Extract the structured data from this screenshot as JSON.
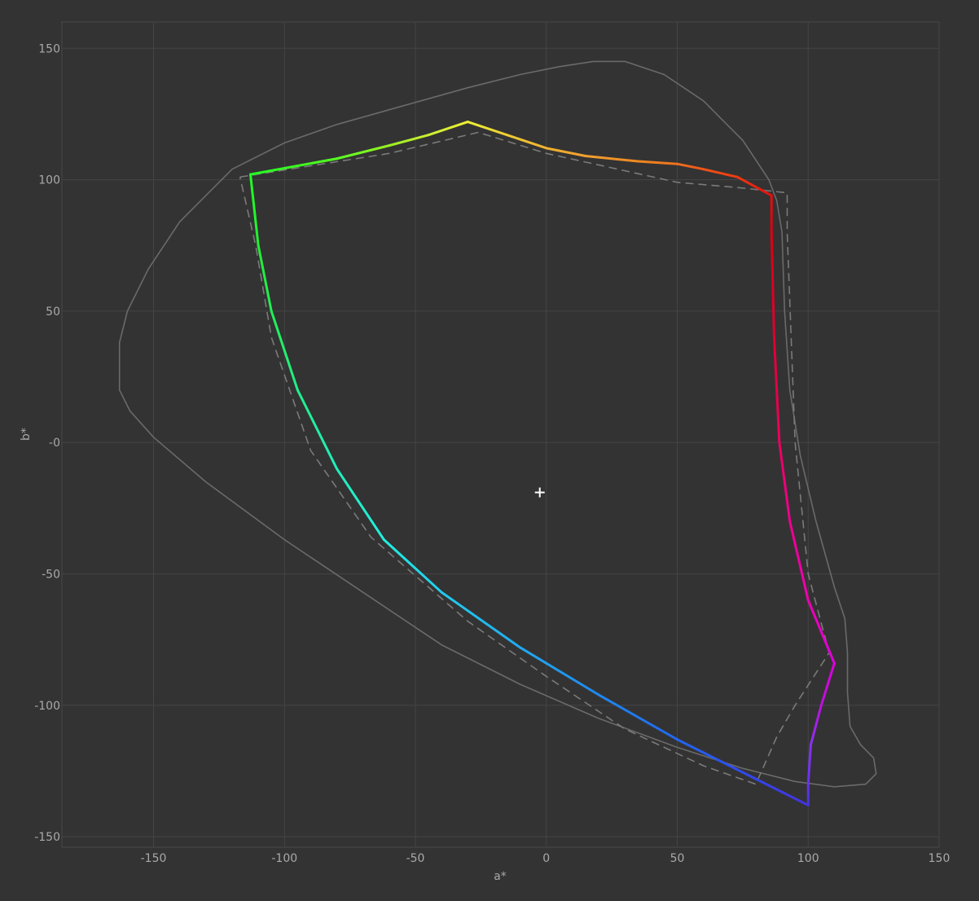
{
  "chart_data": {
    "type": "line",
    "xlabel": "a*",
    "ylabel": "b*",
    "xlim": [
      -185,
      150
    ],
    "ylim": [
      -154,
      160
    ],
    "grid": true,
    "x_ticks": [
      {
        "value": -150,
        "label": "-150"
      },
      {
        "value": -100,
        "label": "-100"
      },
      {
        "value": -50,
        "label": "-50"
      },
      {
        "value": 0,
        "label": "0"
      },
      {
        "value": 50,
        "label": "50"
      },
      {
        "value": 100,
        "label": "100"
      },
      {
        "value": 150,
        "label": "150"
      }
    ],
    "y_ticks": [
      {
        "value": 150,
        "label": "150"
      },
      {
        "value": 100,
        "label": "100"
      },
      {
        "value": 50,
        "label": "50"
      },
      {
        "value": 0,
        "label": "-0"
      },
      {
        "value": -50,
        "label": "-50"
      },
      {
        "value": -100,
        "label": "-100"
      },
      {
        "value": -150,
        "label": "-150"
      }
    ],
    "white_point": {
      "x": -2.5,
      "y": -19
    },
    "series": [
      {
        "style": "solid-gray",
        "color": "#6a6a6a",
        "closed": true,
        "points": [
          [
            18,
            145
          ],
          [
            5,
            143
          ],
          [
            -10,
            140
          ],
          [
            -30,
            135
          ],
          [
            -55,
            128
          ],
          [
            -80,
            121
          ],
          [
            -100,
            114
          ],
          [
            -120,
            104
          ],
          [
            -140,
            84
          ],
          [
            -152,
            66
          ],
          [
            -160,
            50
          ],
          [
            -163,
            38
          ],
          [
            -163,
            20
          ],
          [
            -159,
            12
          ],
          [
            -150,
            2
          ],
          [
            -130,
            -15
          ],
          [
            -100,
            -37
          ],
          [
            -70,
            -57
          ],
          [
            -40,
            -77
          ],
          [
            -10,
            -92
          ],
          [
            20,
            -105
          ],
          [
            50,
            -116
          ],
          [
            75,
            -124
          ],
          [
            95,
            -129
          ],
          [
            110,
            -131
          ],
          [
            122,
            -130
          ],
          [
            126,
            -126
          ],
          [
            125,
            -120
          ],
          [
            120,
            -115
          ],
          [
            116,
            -108
          ],
          [
            115,
            -95
          ],
          [
            115,
            -80
          ],
          [
            114,
            -67
          ],
          [
            110,
            -55
          ],
          [
            103,
            -30
          ],
          [
            97,
            -5
          ],
          [
            93,
            20
          ],
          [
            91,
            50
          ],
          [
            90,
            80
          ],
          [
            88,
            92
          ],
          [
            85,
            100
          ],
          [
            75,
            115
          ],
          [
            60,
            130
          ],
          [
            45,
            140
          ],
          [
            30,
            145
          ]
        ]
      },
      {
        "style": "dashed-gray",
        "color": "#7a7a7a",
        "closed": false,
        "points": [
          [
            -117,
            101
          ],
          [
            -60,
            110
          ],
          [
            -26,
            118
          ],
          [
            0,
            110
          ],
          [
            50,
            99
          ],
          [
            73,
            97
          ],
          [
            92,
            95
          ],
          [
            92,
            80
          ],
          [
            95,
            0
          ],
          [
            100,
            -50
          ],
          [
            108,
            -80
          ],
          [
            95,
            -100
          ],
          [
            88,
            -112
          ],
          [
            80,
            -130
          ],
          [
            60,
            -123
          ],
          [
            30,
            -109
          ],
          [
            0,
            -89
          ],
          [
            -30,
            -68
          ],
          [
            -67,
            -36
          ],
          [
            -90,
            -3
          ],
          [
            -105,
            40
          ],
          [
            -111,
            75
          ],
          [
            -117,
            101
          ]
        ]
      },
      {
        "style": "spectral",
        "closed": true,
        "points": [
          [
            -113,
            102,
            "#22ff22"
          ],
          [
            -80,
            108,
            "#55ff22"
          ],
          [
            -60,
            113,
            "#99ee22"
          ],
          [
            -45,
            117,
            "#ccee33"
          ],
          [
            -30,
            122,
            "#eeee33"
          ],
          [
            -15,
            117,
            "#eecc33"
          ],
          [
            0,
            112,
            "#f0b030"
          ],
          [
            15,
            109,
            "#f0a030"
          ],
          [
            35,
            107,
            "#ee8820"
          ],
          [
            50,
            106,
            "#ee7020"
          ],
          [
            60,
            104,
            "#ee5518"
          ],
          [
            73,
            101,
            "#ee3812"
          ],
          [
            86,
            94,
            "#e01010"
          ],
          [
            86,
            80,
            "#dd0010"
          ],
          [
            87,
            40,
            "#dd0030"
          ],
          [
            89,
            0,
            "#ee0060"
          ],
          [
            93,
            -30,
            "#ee0090"
          ],
          [
            100,
            -60,
            "#ee00b0"
          ],
          [
            110,
            -84,
            "#dd00dd"
          ],
          [
            105,
            -100,
            "#bb11dd"
          ],
          [
            101,
            -115,
            "#8833ee"
          ],
          [
            100,
            -130,
            "#6633ee"
          ],
          [
            100,
            -138,
            "#4433dd"
          ],
          [
            80,
            -128,
            "#3344ee"
          ],
          [
            50,
            -113,
            "#2266ee"
          ],
          [
            20,
            -96,
            "#1f88ee"
          ],
          [
            -10,
            -78,
            "#22aaee"
          ],
          [
            -40,
            -57,
            "#22ccee"
          ],
          [
            -62,
            -37,
            "#22eedd"
          ],
          [
            -80,
            -10,
            "#22eebb"
          ],
          [
            -95,
            20,
            "#22ee88"
          ],
          [
            -105,
            50,
            "#22ee55"
          ],
          [
            -110,
            75,
            "#22ee33"
          ],
          [
            -113,
            102,
            "#22ff22"
          ]
        ]
      }
    ]
  }
}
